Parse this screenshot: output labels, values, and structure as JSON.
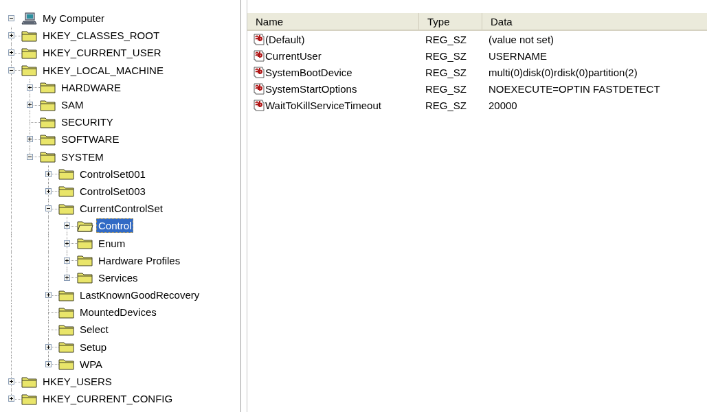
{
  "tree": [
    {
      "label": "My Computer",
      "kind": "computer",
      "expanded": true,
      "selected": false,
      "children": [
        {
          "label": "HKEY_CLASSES_ROOT",
          "kind": "folder",
          "expanded": false,
          "selected": false
        },
        {
          "label": "HKEY_CURRENT_USER",
          "kind": "folder",
          "expanded": false,
          "selected": false
        },
        {
          "label": "HKEY_LOCAL_MACHINE",
          "kind": "folder",
          "expanded": true,
          "selected": false,
          "children": [
            {
              "label": "HARDWARE",
              "kind": "folder",
              "expanded": false,
              "selected": false
            },
            {
              "label": "SAM",
              "kind": "folder",
              "expanded": false,
              "selected": false
            },
            {
              "label": "SECURITY",
              "kind": "folder",
              "selected": false
            },
            {
              "label": "SOFTWARE",
              "kind": "folder",
              "expanded": false,
              "selected": false
            },
            {
              "label": "SYSTEM",
              "kind": "folder",
              "expanded": true,
              "selected": false,
              "children": [
                {
                  "label": "ControlSet001",
                  "kind": "folder",
                  "expanded": false,
                  "selected": false
                },
                {
                  "label": "ControlSet003",
                  "kind": "folder",
                  "expanded": false,
                  "selected": false
                },
                {
                  "label": "CurrentControlSet",
                  "kind": "folder",
                  "expanded": true,
                  "selected": false,
                  "children": [
                    {
                      "label": "Control",
                      "kind": "folder",
                      "expanded": false,
                      "selected": true
                    },
                    {
                      "label": "Enum",
                      "kind": "folder",
                      "expanded": false,
                      "selected": false
                    },
                    {
                      "label": "Hardware Profiles",
                      "kind": "folder",
                      "expanded": false,
                      "selected": false
                    },
                    {
                      "label": "Services",
                      "kind": "folder",
                      "expanded": false,
                      "selected": false
                    }
                  ]
                },
                {
                  "label": "LastKnownGoodRecovery",
                  "kind": "folder",
                  "expanded": false,
                  "selected": false
                },
                {
                  "label": "MountedDevices",
                  "kind": "folder",
                  "selected": false
                },
                {
                  "label": "Select",
                  "kind": "folder",
                  "selected": false
                },
                {
                  "label": "Setup",
                  "kind": "folder",
                  "expanded": false,
                  "selected": false
                },
                {
                  "label": "WPA",
                  "kind": "folder",
                  "expanded": false,
                  "selected": false
                }
              ]
            }
          ]
        },
        {
          "label": "HKEY_USERS",
          "kind": "folder",
          "expanded": false,
          "selected": false
        },
        {
          "label": "HKEY_CURRENT_CONFIG",
          "kind": "folder",
          "expanded": false,
          "selected": false
        }
      ]
    }
  ],
  "table": {
    "columns": [
      "Name",
      "Type",
      "Data"
    ],
    "rows": [
      {
        "name": "(Default)",
        "type": "REG_SZ",
        "data": "(value not set)"
      },
      {
        "name": "CurrentUser",
        "type": "REG_SZ",
        "data": "USERNAME"
      },
      {
        "name": "SystemBootDevice",
        "type": "REG_SZ",
        "data": "multi(0)disk(0)rdisk(0)partition(2)"
      },
      {
        "name": "SystemStartOptions",
        "type": "REG_SZ",
        "data": "NOEXECUTE=OPTIN  FASTDETECT"
      },
      {
        "name": "WaitToKillServiceTimeout",
        "type": "REG_SZ",
        "data": "20000"
      }
    ]
  }
}
